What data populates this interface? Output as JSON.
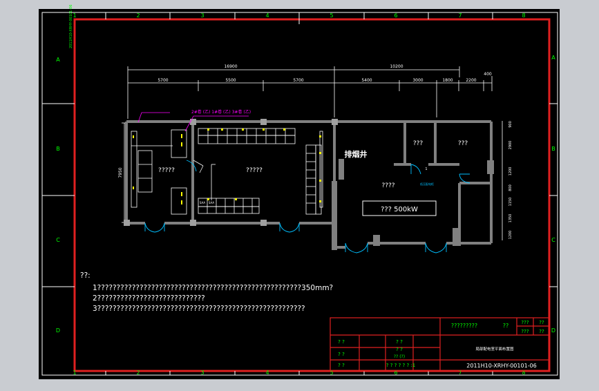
{
  "colors": {
    "background": "#c9ccd1",
    "canvas": "#000000",
    "frame": "#ffffff",
    "border": "#e02020",
    "grid_labels": "#00ff00",
    "walls": "#808080",
    "text": "#ffffff",
    "magenta": "#ff00ff",
    "yellow": "#ffff00",
    "cyan": "#00bfff"
  },
  "frame": {
    "col_labels": [
      "1",
      "2",
      "3",
      "4",
      "5",
      "6",
      "7",
      "8"
    ],
    "row_labels": [
      "A",
      "B",
      "C",
      "D"
    ],
    "side_code": "2011H10-XRHY-00101-06"
  },
  "dims": {
    "top_overall": [
      "16900",
      "10200",
      "400"
    ],
    "top_segments": [
      "5700",
      "5500",
      "5700",
      "5400",
      "3000",
      "1800",
      "2200"
    ],
    "left": "7950",
    "right": [
      "900",
      "2900",
      "1200",
      "800",
      "1150",
      "1350",
      "1200"
    ]
  },
  "plan": {
    "room_left_small": "?????",
    "room_left_large": "?????",
    "room_right_main": "????",
    "room_top_a": "???",
    "room_top_b": "???",
    "equipment_label": "??? 500kW",
    "chimney": "排烟井",
    "magenta_note": "2#卷 (乙) 1#卷 (乙) 3#卷 (乙)",
    "cabinet_codes": [
      "SAA",
      "SAA"
    ],
    "door_code": "1",
    "cyan_label": "低压配电柜"
  },
  "notes": {
    "heading": "??:",
    "line1": "1?????????????????????????????????????????????????????350mm?",
    "line2": "2????????????????????????????",
    "line3": "3??????????????????????????????????????????????????????"
  },
  "title_block": {
    "name": "?????????",
    "name_right": "??",
    "cell_r1a": "???",
    "cell_r1b": "??",
    "cell_r2a": "???",
    "cell_r2b": "??",
    "desc": "局部配电室平面布置图",
    "q1": "? ?",
    "q2": "? ?",
    "q3": "? ?",
    "q4": "? ?",
    "q5": "? ?",
    "q6": "?? (?)",
    "bottom_mid": "? ? ? ? ? ? :1",
    "code": "2011H10-XRHY-00101-06"
  }
}
